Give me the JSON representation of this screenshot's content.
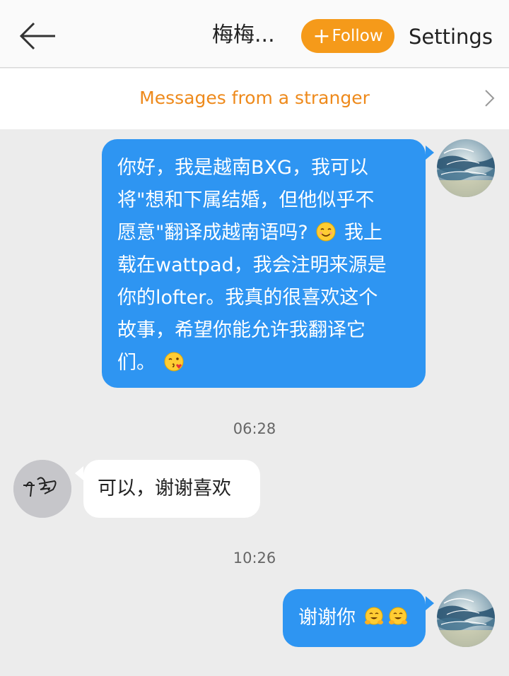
{
  "header": {
    "title": "梅梅...",
    "follow_label": "Follow",
    "settings_label": "Settings"
  },
  "stranger_bar": {
    "text": "Messages from a stranger"
  },
  "messages": [
    {
      "direction": "outgoing",
      "lines": [
        "你好，我是越南BXG，我可以",
        "将\"想和下属结婚，但他似乎不",
        "愿意\"翻译成越南语吗?",
        "我上",
        "载在wattpad，我会注明来源是",
        "你的lofter。我真的很喜欢这个",
        "故事，希望你能允许我翻译它",
        "们。"
      ],
      "emojis": [
        "smiling-face-emoji",
        "kissing-face-emoji"
      ]
    },
    {
      "direction": "incoming",
      "time": "06:28",
      "text": "可以，谢谢喜欢"
    },
    {
      "direction": "outgoing",
      "time": "10:26",
      "text": "谢谢你",
      "emojis": [
        "hugging-face-emoji",
        "hugging-face-emoji"
      ]
    }
  ],
  "colors": {
    "accent_orange": "#f59a1a",
    "stranger_text": "#ee8a1c",
    "bubble_out": "#2e95f2",
    "bubble_in": "#ffffff",
    "background": "#ececec"
  }
}
